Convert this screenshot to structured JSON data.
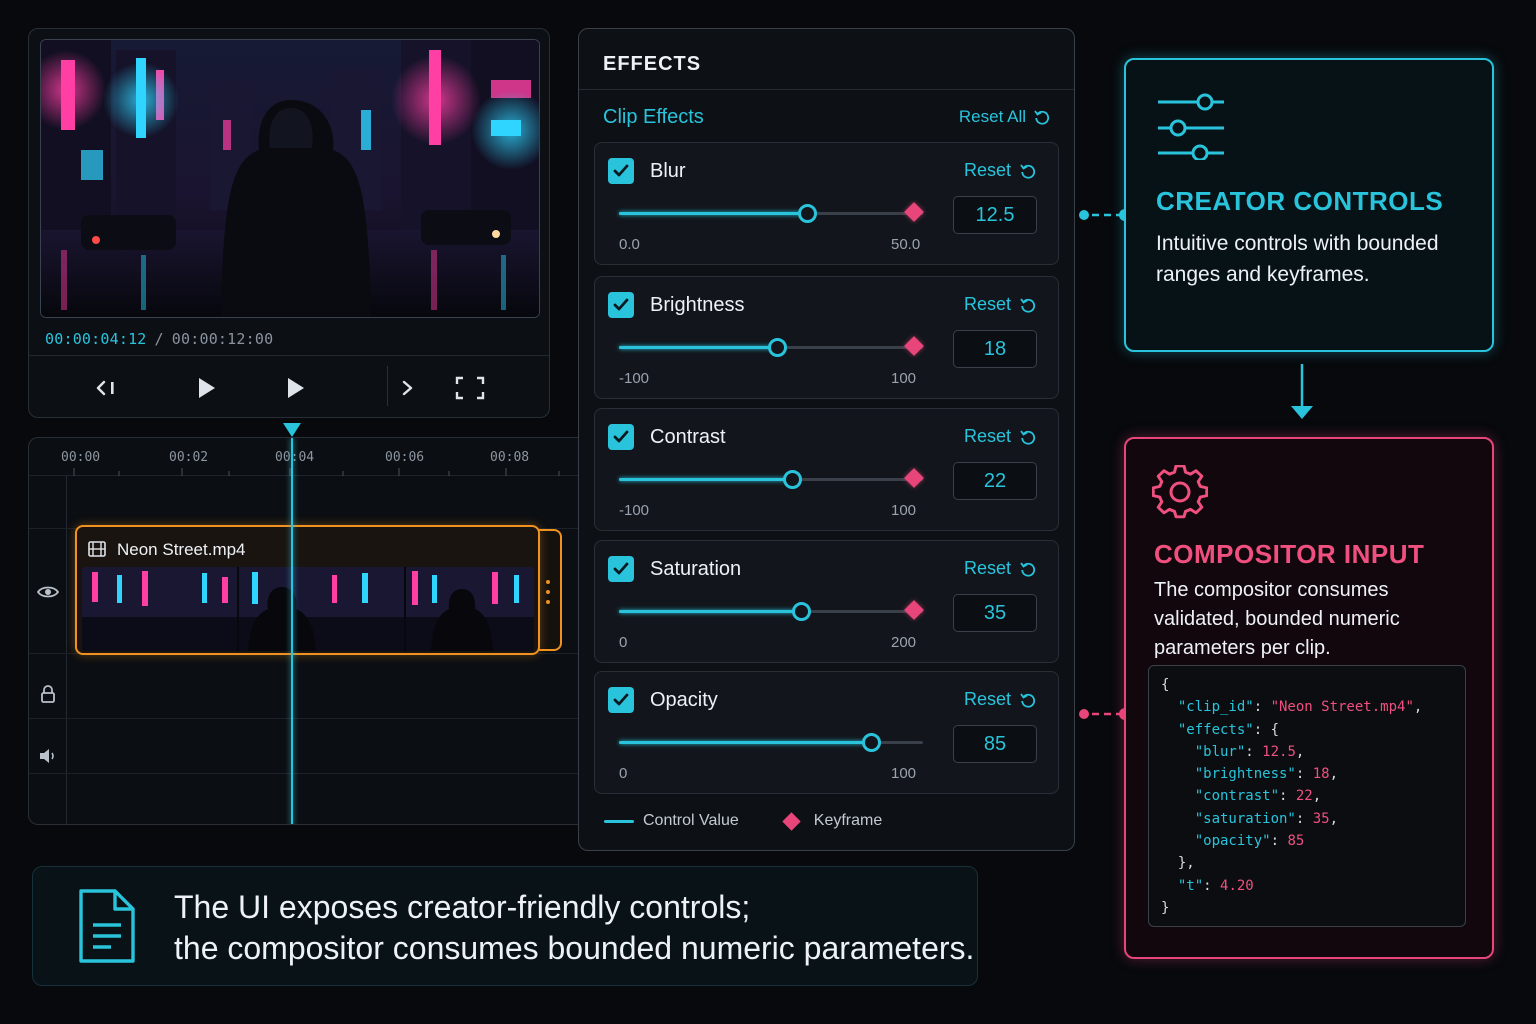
{
  "preview": {
    "timecode_current": "00:00:04:12",
    "timecode_separator": "/",
    "timecode_total": "00:00:12:00"
  },
  "transport": {
    "buttons": [
      "step-back-icon",
      "play-icon",
      "play-icon",
      "step-forward-icon",
      "fullscreen-icon"
    ]
  },
  "timeline": {
    "ticks": [
      "00:00",
      "00:02",
      "00:04",
      "00:06",
      "00:08"
    ],
    "clip_name": "Neon Street.mp4",
    "playhead_time_s": 4.2
  },
  "effects": {
    "title": "EFFECTS",
    "section_label": "Clip Effects",
    "reset_all_label": "Reset All",
    "reset_label": "Reset",
    "items": [
      {
        "name": "Blur",
        "value": "12.5",
        "min": "0.0",
        "max": "50.0",
        "level": 0.62,
        "keyframe": true,
        "checked": true
      },
      {
        "name": "Brightness",
        "value": "18",
        "min": "-100",
        "max": "100",
        "level": 0.52,
        "keyframe": true,
        "checked": true
      },
      {
        "name": "Contrast",
        "value": "22",
        "min": "-100",
        "max": "100",
        "level": 0.57,
        "keyframe": true,
        "checked": true
      },
      {
        "name": "Saturation",
        "value": "35",
        "min": "0",
        "max": "200",
        "level": 0.6,
        "keyframe": true,
        "checked": true
      },
      {
        "name": "Opacity",
        "value": "85",
        "min": "0",
        "max": "100",
        "level": 0.83,
        "keyframe": false,
        "checked": true
      }
    ],
    "legend_value": "Control Value",
    "legend_keyframe": "Keyframe"
  },
  "creator": {
    "title": "CREATOR CONTROLS",
    "description": "Intuitive controls with bounded ranges and keyframes."
  },
  "compositor": {
    "title": "COMPOSITOR INPUT",
    "description": "The compositor consumes validated, bounded numeric parameters per clip.",
    "json": {
      "open": "{",
      "clip_id_key": "\"clip_id\"",
      "clip_id_val": "\"Neon Street.mp4\"",
      "effects_key": "\"effects\"",
      "blur_key": "\"blur\"",
      "blur_val": "12.5",
      "brightness_key": "\"brightness\"",
      "brightness_val": "18",
      "contrast_key": "\"contrast\"",
      "contrast_val": "22",
      "saturation_key": "\"saturation\"",
      "saturation_val": "35",
      "opacity_key": "\"opacity\"",
      "opacity_val": "85",
      "t_key": "\"t\"",
      "t_val": "4.20",
      "close": "}"
    }
  },
  "caption": {
    "line1": "The UI exposes creator-friendly controls;",
    "line2": "the compositor consumes bounded numeric parameters."
  },
  "colors": {
    "accent_cyan": "#29c4dc",
    "accent_pink": "#e8457a",
    "clip_orange": "#f0921f",
    "background": "#07090c"
  }
}
